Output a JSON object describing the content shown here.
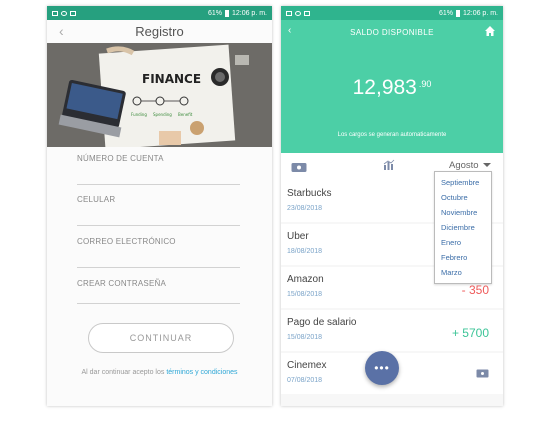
{
  "status_bar": {
    "battery": "61%",
    "time": "12:06 p. m."
  },
  "registro": {
    "title": "Registro",
    "back_icon": "chevron-left-icon",
    "hero_text": "FINANCE",
    "hero_labels": [
      "Funding",
      "Spending",
      "Benefit"
    ],
    "fields": [
      "NÚMERO DE CUENTA",
      "CELULAR",
      "CORREO ELECTRÓNICO",
      "CREAR CONTRASEÑA"
    ],
    "continue_label": "CONTINUAR",
    "terms_prefix": "Al dar continuar acepto los ",
    "terms_link": "términos y condiciones"
  },
  "saldo": {
    "title": "SALDO DISPONIBLE",
    "amount_int": "12,983",
    "amount_dec": ".90",
    "note": "Los cargos se generan automaticamente",
    "month": "Agosto",
    "months_dropdown": [
      "Septiembre",
      "Octubre",
      "Noviembre",
      "Diciembre",
      "Enero",
      "Febrero",
      "Marzo"
    ],
    "transactions": [
      {
        "name": "Starbucks",
        "date": "23/08/2018",
        "amount": ""
      },
      {
        "name": "Uber",
        "date": "18/08/2018",
        "amount": ""
      },
      {
        "name": "Amazon",
        "date": "15/08/2018",
        "amount": "- 350"
      },
      {
        "name": "Pago de salario",
        "date": "15/08/2018",
        "amount": "+ 5700"
      },
      {
        "name": "Cinemex",
        "date": "07/08/2018",
        "amount": ""
      }
    ],
    "fab_label": "•••",
    "colors": {
      "teal": "#4ccfa6",
      "negative": "#ef5a5a",
      "positive": "#3cc497",
      "fab": "#5a71a6"
    }
  }
}
